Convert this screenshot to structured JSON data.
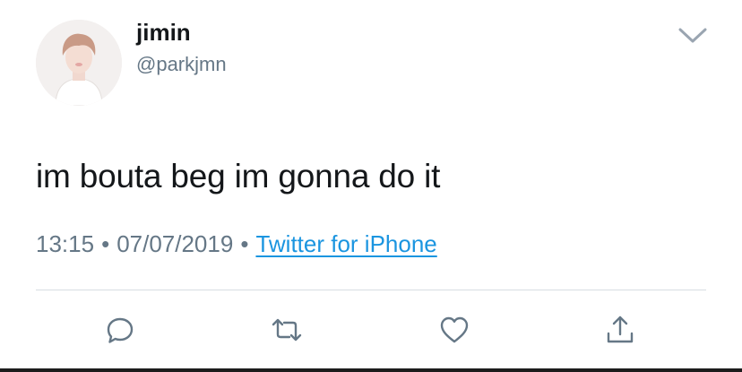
{
  "author": {
    "display_name": "jimin",
    "handle": "@parkjmn",
    "avatar_icon": "profile-photo"
  },
  "tweet": {
    "text": "im bouta beg im gonna do it",
    "time": "13:15",
    "date": "07/07/2019",
    "separator": "•",
    "source": "Twitter for iPhone"
  },
  "icons": {
    "menu": "chevron-down-icon",
    "reply": "reply-icon",
    "retweet": "retweet-icon",
    "like": "heart-icon",
    "share": "share-icon"
  },
  "colors": {
    "text": "#14171a",
    "secondary": "#657786",
    "link": "#1b95e0",
    "divider": "#d7dde2"
  }
}
